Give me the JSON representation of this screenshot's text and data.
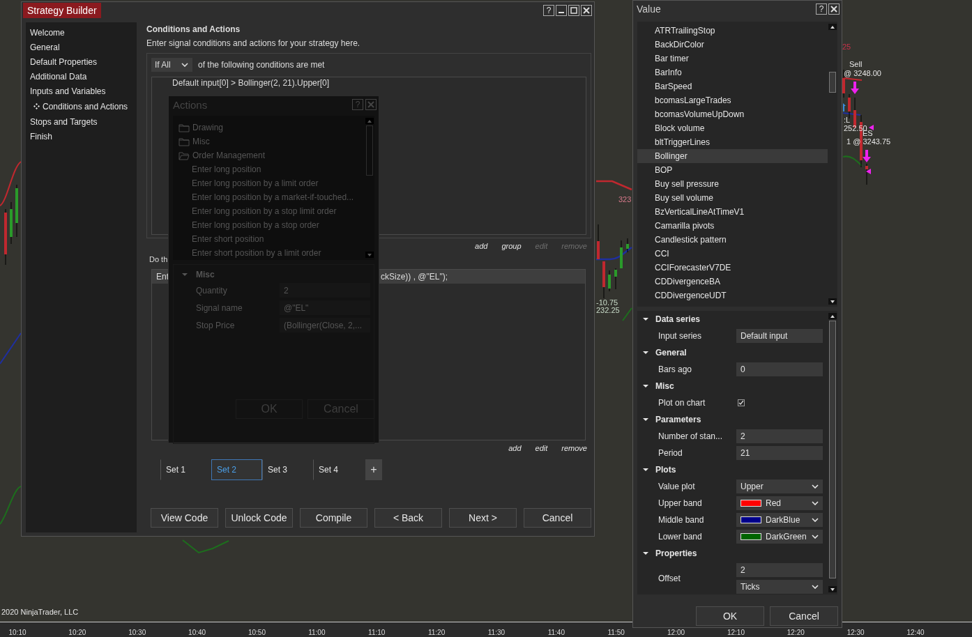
{
  "chart": {
    "labels": [
      {
        "text": "25",
        "color": "#c8324b"
      },
      {
        "text": "Sell",
        "color": "#e6e6e6"
      },
      {
        "text": "@ 3248.00",
        "color": "#e6e6e6"
      },
      {
        "text": ":L",
        "color": "#e6e6e6"
      },
      {
        "text": "252.50",
        "color": "#e6e6e6"
      },
      {
        "text": "ES",
        "color": "#e6e6e6"
      },
      {
        "text": "1 @ 3243.75",
        "color": "#e6e6e6"
      },
      {
        "text": "323",
        "color": "#d97a8c"
      },
      {
        "text": "-10.75",
        "color": "#c9dcc9"
      },
      {
        "text": "232.25",
        "color": "#c9dcc9"
      }
    ],
    "copyright": "2020 NinjaTrader, LLC",
    "time_axis": [
      "10:10",
      "10:20",
      "10:30",
      "10:40",
      "10:50",
      "11:00",
      "11:10",
      "11:20",
      "11:30",
      "11:40",
      "11:50",
      "12:00",
      "12:10",
      "12:20",
      "12:30",
      "12:40"
    ]
  },
  "strategy_builder": {
    "title": "Strategy Builder",
    "help": "?",
    "nav": [
      {
        "label": "Welcome",
        "selected": false
      },
      {
        "label": "General",
        "selected": false
      },
      {
        "label": "Default Properties",
        "selected": false
      },
      {
        "label": "Additional Data",
        "selected": false
      },
      {
        "label": "Inputs and Variables",
        "selected": false
      },
      {
        "label": "Conditions and Actions",
        "selected": true
      },
      {
        "label": "Stops and Targets",
        "selected": false
      },
      {
        "label": "Finish",
        "selected": false
      }
    ],
    "heading": "Conditions and Actions",
    "description": "Enter signal conditions and actions for your strategy here.",
    "conditions": {
      "mode": "If All",
      "mode_suffix": "of the following conditions are met",
      "items": [
        "Default input[0] > Bollinger(2, 21).Upper[0]"
      ],
      "links": [
        {
          "label": "add",
          "disabled": false
        },
        {
          "label": "group",
          "disabled": false
        },
        {
          "label": "edit",
          "disabled": true
        },
        {
          "label": "remove",
          "disabled": true
        }
      ]
    },
    "actions": {
      "label": "Do th",
      "rows": [
        {
          "start": "Ent",
          "end": "ckSize)) , @\"EL\");",
          "selected": true
        }
      ],
      "links": [
        {
          "label": "add",
          "disabled": false
        },
        {
          "label": "edit",
          "disabled": false
        },
        {
          "label": "remove",
          "disabled": false
        }
      ]
    },
    "sets": [
      {
        "label": "Set 1",
        "selected": false
      },
      {
        "label": "Set 2",
        "selected": true
      },
      {
        "label": "Set 3",
        "selected": false
      },
      {
        "label": "Set 4",
        "selected": false
      }
    ],
    "add_set": "+",
    "buttons": [
      "View Code",
      "Unlock Code",
      "Compile",
      "< Back",
      "Next >",
      "Cancel"
    ]
  },
  "actions_dialog": {
    "title": "Actions",
    "help": "?",
    "tree": [
      {
        "label": "Drawing",
        "expanded": false
      },
      {
        "label": "Misc",
        "expanded": false
      },
      {
        "label": "Order Management",
        "expanded": true,
        "children": [
          {
            "label": "Enter long position"
          },
          {
            "label": "Enter long position by a limit order"
          },
          {
            "label": "Enter long position by a market-if-touched..."
          },
          {
            "label": "Enter long position by a stop limit order"
          },
          {
            "label": "Enter long position by a stop order"
          },
          {
            "label": "Enter short position"
          },
          {
            "label": "Enter short position by a limit order"
          }
        ]
      }
    ],
    "section": {
      "name": "Misc",
      "expanded": true
    },
    "properties": [
      {
        "name": "Quantity",
        "value": "2"
      },
      {
        "name": "Signal name",
        "value": "@\"EL\""
      },
      {
        "name": "Stop Price",
        "value": "(Bollinger(Close, 2,..."
      }
    ],
    "buttons": [
      "OK",
      "Cancel"
    ]
  },
  "value_window": {
    "title": "Value",
    "help": "?",
    "items": [
      {
        "label": "ATRTrailingStop",
        "selected": false
      },
      {
        "label": "BackDirColor",
        "selected": false
      },
      {
        "label": "Bar timer",
        "selected": false
      },
      {
        "label": "BarInfo",
        "selected": false
      },
      {
        "label": "BarSpeed",
        "selected": false
      },
      {
        "label": "bcomasLargeTrades",
        "selected": false
      },
      {
        "label": "bcomasVolumeUpDown",
        "selected": false
      },
      {
        "label": "Block volume",
        "selected": false
      },
      {
        "label": "bltTriggerLines",
        "selected": false
      },
      {
        "label": "Bollinger",
        "selected": true
      },
      {
        "label": "BOP",
        "selected": false
      },
      {
        "label": "Buy sell pressure",
        "selected": false
      },
      {
        "label": "Buy sell volume",
        "selected": false
      },
      {
        "label": "BzVerticalLineAtTimeV1",
        "selected": false
      },
      {
        "label": "Camarilla pivots",
        "selected": false
      },
      {
        "label": "Candlestick pattern",
        "selected": false
      },
      {
        "label": "CCI",
        "selected": false
      },
      {
        "label": "CCIForecasterV7DE",
        "selected": false
      },
      {
        "label": "CDDivergenceBA",
        "selected": false
      },
      {
        "label": "CDDivergenceUDT",
        "selected": false
      }
    ],
    "categories": [
      {
        "name": "Data series",
        "expanded": true,
        "rows": [
          {
            "kind": "text",
            "name": "Input series",
            "value": "Default input"
          }
        ]
      },
      {
        "name": "General",
        "expanded": true,
        "rows": [
          {
            "kind": "text",
            "name": "Bars ago",
            "value": "0"
          }
        ]
      },
      {
        "name": "Misc",
        "expanded": true,
        "rows": [
          {
            "kind": "checkbox",
            "name": "Plot on chart",
            "checked": true
          }
        ]
      },
      {
        "name": "Parameters",
        "expanded": true,
        "rows": [
          {
            "kind": "text",
            "name": "Number of stan...",
            "value": "2"
          },
          {
            "kind": "text",
            "name": "Period",
            "value": "21"
          }
        ]
      },
      {
        "name": "Plots",
        "expanded": true,
        "rows": [
          {
            "kind": "dropdown",
            "name": "Value plot",
            "value": "Upper"
          },
          {
            "kind": "color",
            "name": "Upper band",
            "value": "Red",
            "color": "#ff0000"
          },
          {
            "kind": "color",
            "name": "Middle band",
            "value": "DarkBlue",
            "color": "#00008b"
          },
          {
            "kind": "color",
            "name": "Lower band",
            "value": "DarkGreen",
            "color": "#006400"
          }
        ]
      },
      {
        "name": "Properties",
        "expanded": true,
        "rows": [
          {
            "kind": "pair",
            "name": "Offset",
            "value": "2",
            "unit": "Ticks"
          }
        ]
      }
    ],
    "buttons": [
      "OK",
      "Cancel"
    ]
  }
}
